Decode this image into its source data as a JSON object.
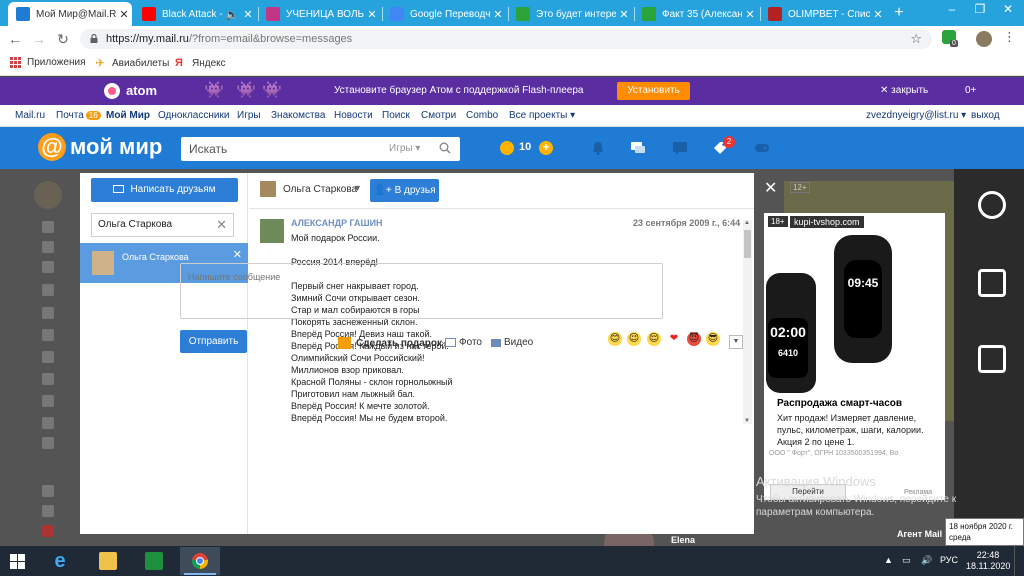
{
  "tabs": [
    {
      "title": "Мой Мир@Mail.Ru",
      "favicon_color": "#1f7bd4",
      "active": true
    },
    {
      "title": "Black Attack - ",
      "favicon_color": "#ff0000",
      "active": false
    },
    {
      "title": "УЧЕНИЦА ВОЛЬФ",
      "favicon_color": "#c13584",
      "active": false
    },
    {
      "title": "Google Переводч",
      "favicon_color": "#4285f4",
      "active": false
    },
    {
      "title": "Это будет интерес",
      "favicon_color": "#2aa33a",
      "active": false
    },
    {
      "title": "Факт 35 (Алексан",
      "favicon_color": "#2aa33a",
      "active": false
    },
    {
      "title": "OLIMPBET - Списо",
      "favicon_color": "#b22222",
      "active": false
    }
  ],
  "browser": {
    "url_host": "https://my.mail.ru",
    "url_path": "/?from=email&browse=messages",
    "extension_badge": "0"
  },
  "bookmarks": [
    {
      "label": "Приложения",
      "icon": "apps-grid-icon"
    },
    {
      "label": "Авиабилеты",
      "icon": "plane-icon"
    },
    {
      "label": "Яндекс",
      "icon": "yandex-icon"
    }
  ],
  "atom_banner": {
    "brand": "atom",
    "text": "Установите браузер Атом с поддержкой Flash-плеера",
    "button": "Установить",
    "close": "закрыть",
    "count": "0+"
  },
  "portal": {
    "links": [
      "Mail.ru",
      "Почта",
      "Мой Мир",
      "Одноклассники",
      "Игры",
      "Знакомства",
      "Новости",
      "Поиск",
      "Смотри",
      "Combo",
      "Все проекты"
    ],
    "mail_count": "16",
    "email": "zvezdnyeigry@list.ru",
    "logout": "выход"
  },
  "header": {
    "logo": "мой мир",
    "search_placeholder": "Искать",
    "search_scope": "Игры",
    "coins": "10",
    "notification_badge": "2"
  },
  "dialog": {
    "send_to_friends": "Написать друзьям",
    "filter_value": "Ольга Старкова",
    "contact_name": "Ольга Старкова",
    "recipient": "Ольга Старкова",
    "add_friend": "В друзья",
    "message": {
      "author": "АЛЕКСАНДР ГАШИН",
      "date": "23 сентября 2009 г., 6:44",
      "lines": [
        "Мой подарок России.",
        "",
        "Россия 2014 вперёд!",
        "",
        "Первый снег накрывает город.",
        "Зимний Сочи открывает сезон.",
        "Стар и мал собираются в горы",
        "Покорять заснеженный склон.",
        "Вперёд Россия! Девиз наш такой.",
        "Вперёд Россия! Каждый из нас герой.",
        "Олимпийский Сочи Российский!",
        "Миллионов взор приковал.",
        "Красной Поляны - склон горнолыжный",
        "Приготовил нам лыжный бал.",
        "Вперёд Россия! К мечте золотой.",
        "Вперёд Россия! Мы не будем второй."
      ]
    },
    "compose_placeholder": "Напишите сообщение",
    "send": "Отправить",
    "gift": "Сделать подарок",
    "photo": "Фото",
    "video": "Видео",
    "emojis": [
      "😊",
      "😉",
      "😌",
      "❤",
      "😈",
      "😎"
    ]
  },
  "ad": {
    "age": "18+",
    "age_top": "12+",
    "domain": "kupi-tvshop.com",
    "watch_time": "09:45",
    "watch_time_2": "02:00",
    "watch_steps": "6410",
    "title": "Распродажа смарт-часов",
    "description": "Хит продаж! Измеряет давление, пульс, километраж, шаги, калории. Акция 2 по цене 1.",
    "legal": "ООО \" Форт\", ОГРН 1033500351994, Во",
    "button": "Перейти",
    "label": "Реклама"
  },
  "background": {
    "elena": "Elena",
    "agent": "Агент Mail"
  },
  "windows": {
    "activation_title": "Активация Windows",
    "activation_text": "Чтобы активировать Windows, перейдите к параметрам компьютера.",
    "tooltip_date": "18 ноября 2020 г.",
    "tooltip_day": "среда",
    "lang": "РУС",
    "time": "22:48",
    "date": "18.11.2020"
  }
}
